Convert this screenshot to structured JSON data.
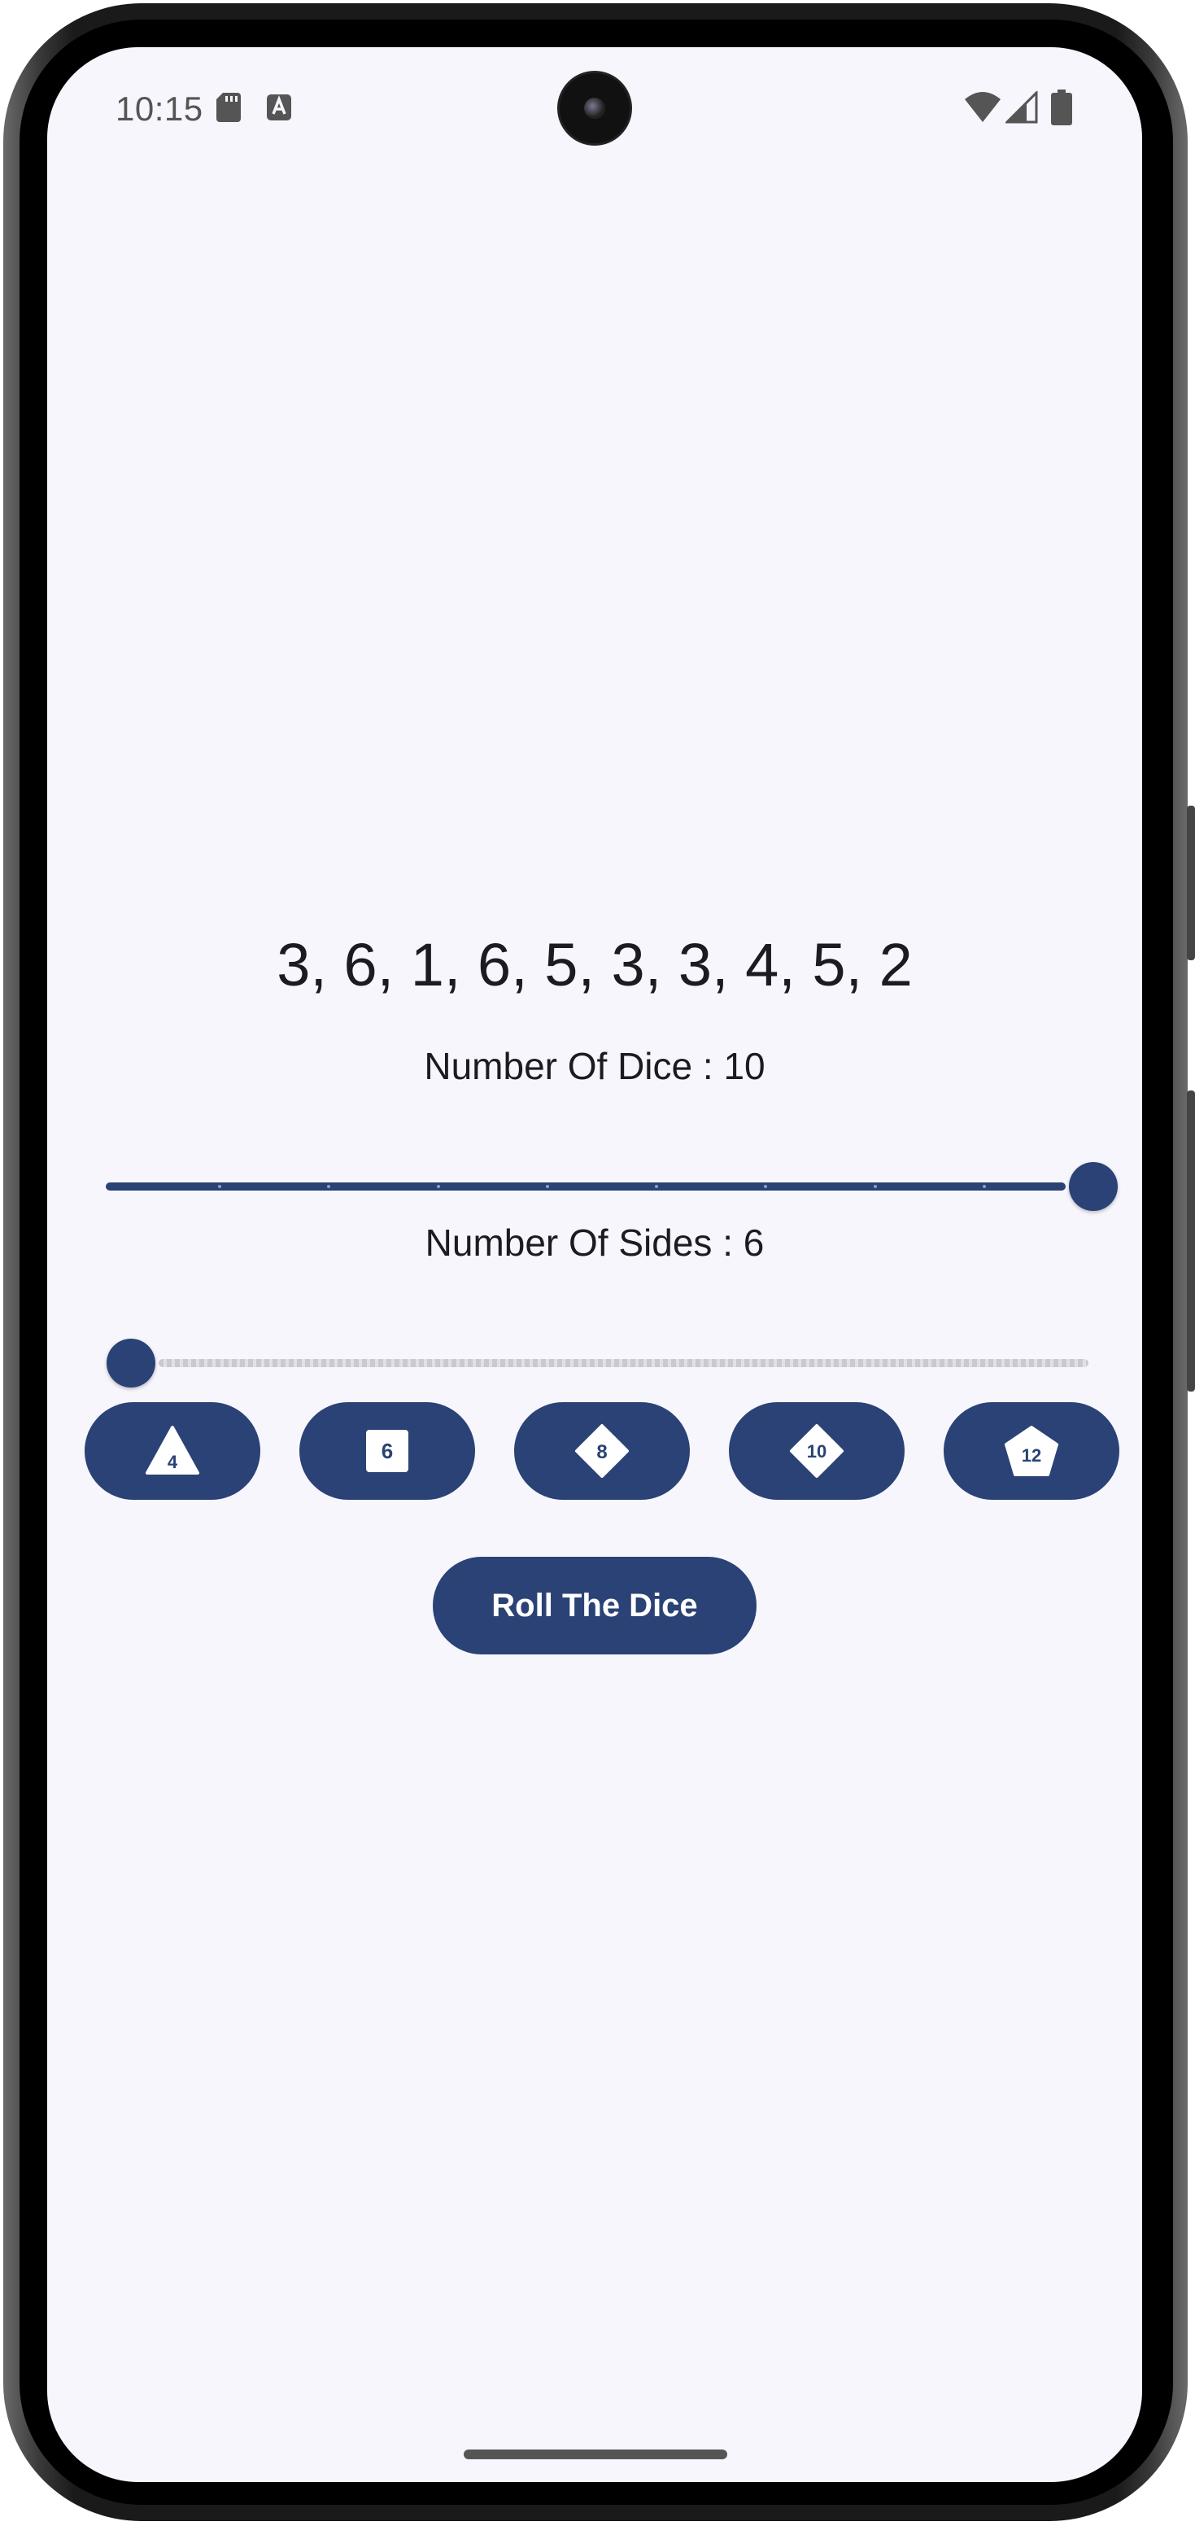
{
  "status_bar": {
    "time": "10:15",
    "left_icons": [
      "sd-card-icon",
      "a-notification-icon"
    ],
    "right_icons": [
      "wifi-icon",
      "cellular-icon",
      "battery-icon"
    ]
  },
  "result": "3, 6, 1, 6, 5, 3, 3, 4, 5, 2",
  "dice_count": {
    "label": "Number Of Dice : 10",
    "value": 10,
    "min": 1,
    "max": 10
  },
  "sides": {
    "label": "Number Of Sides : 6",
    "value": 6,
    "min": 4,
    "max": 100
  },
  "die_buttons": [
    {
      "shape": "triangle-icon",
      "label": "4"
    },
    {
      "shape": "square-icon",
      "label": "6"
    },
    {
      "shape": "diamond-icon",
      "label": "8"
    },
    {
      "shape": "diamond-icon",
      "label": "10"
    },
    {
      "shape": "pentagon-icon",
      "label": "12"
    }
  ],
  "roll_button": "Roll The Dice",
  "colors": {
    "primary": "#2a4275",
    "background": "#f7f6fc",
    "text": "#1b1b21"
  }
}
